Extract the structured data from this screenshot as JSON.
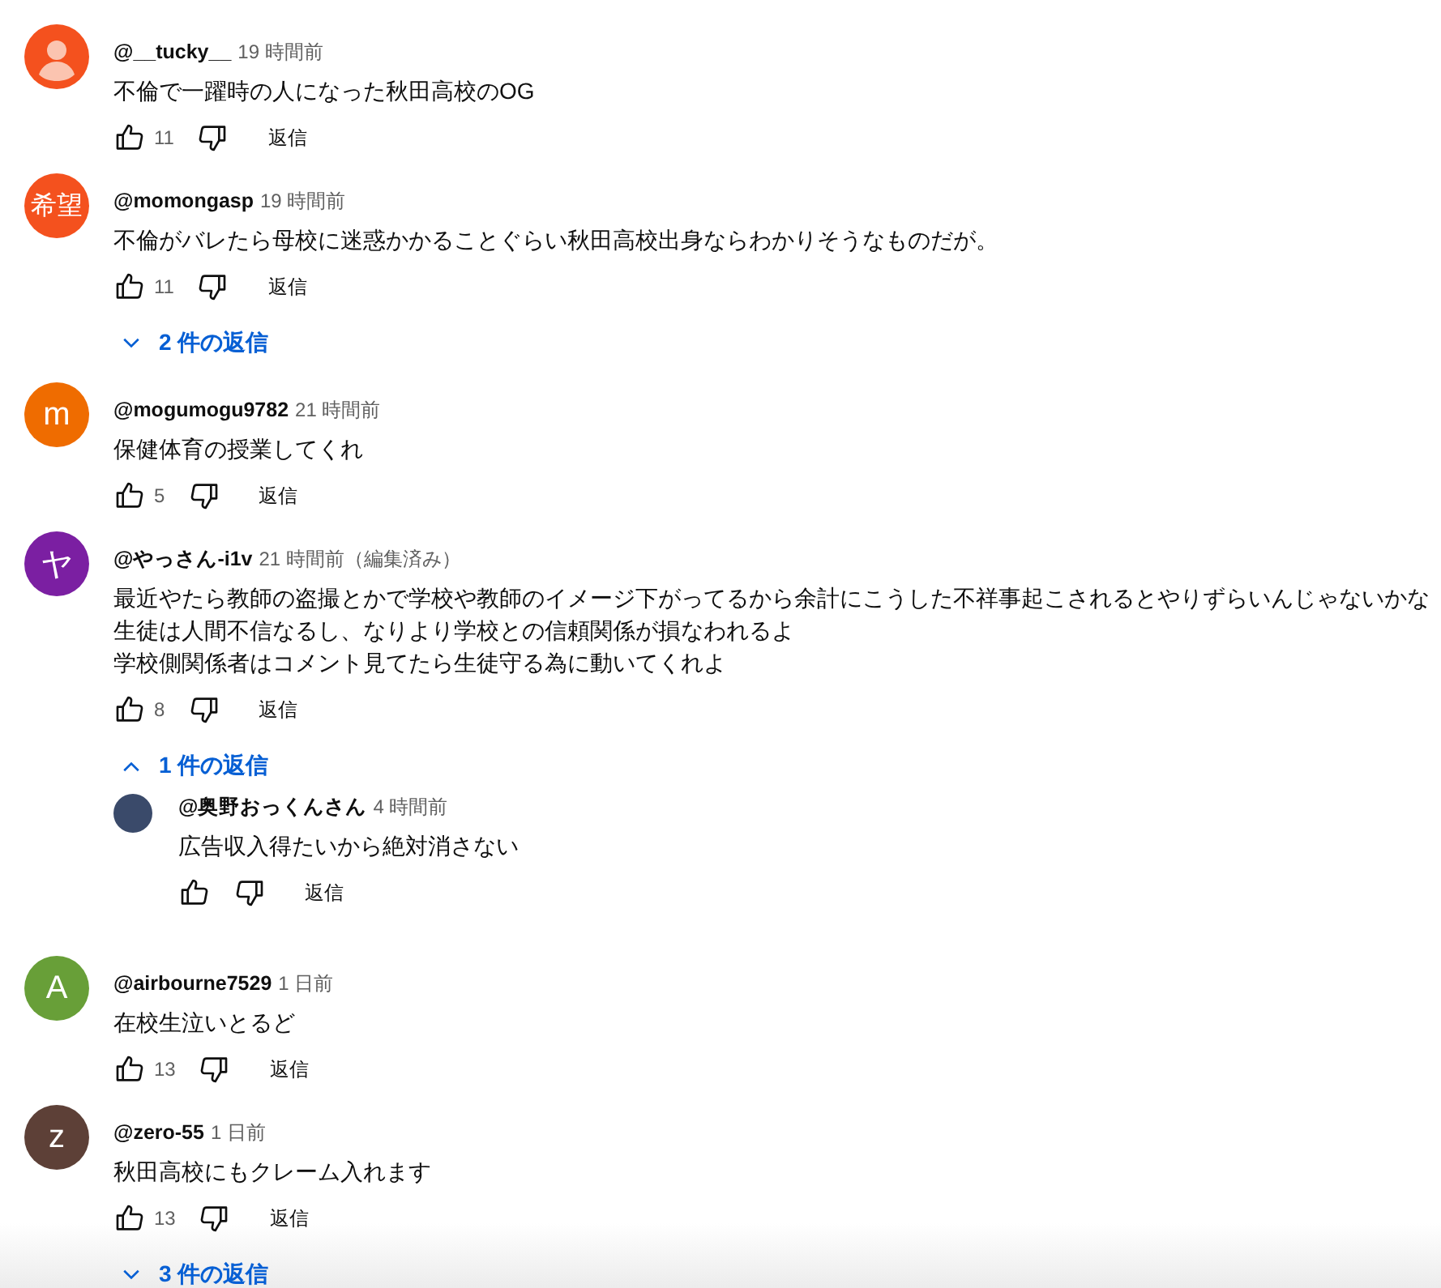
{
  "comments": [
    {
      "avatar": {
        "kind": "silhouette",
        "color": "#f4511e"
      },
      "author": "@__tucky__",
      "time": "19 時間前",
      "lines": [
        "不倫で一躍時の人になった秋田高校のOG"
      ],
      "likes": "11",
      "reply_label": "返信"
    },
    {
      "avatar": {
        "kind": "initial",
        "text": "希望",
        "color": "#f4511e"
      },
      "author": "@momongasp",
      "time": "19 時間前",
      "lines": [
        "不倫がバレたら母校に迷惑かかることぐらい秋田高校出身ならわかりそうなものだが。"
      ],
      "likes": "11",
      "reply_label": "返信",
      "replies_toggle": {
        "label": "2 件の返信",
        "expanded": false
      }
    },
    {
      "avatar": {
        "kind": "initial",
        "text": "m",
        "color": "#ef6c00"
      },
      "author": "@mogumogu9782",
      "time": "21 時間前",
      "lines": [
        "保健体育の授業してくれ"
      ],
      "likes": "5",
      "reply_label": "返信"
    },
    {
      "avatar": {
        "kind": "initial",
        "text": "ヤ",
        "color": "#7b1fa2"
      },
      "author": "@やっさん-i1v",
      "time": "21 時間前（編集済み）",
      "lines": [
        "最近やたら教師の盗撮とかで学校や教師のイメージ下がってるから余計にこうした不祥事起こされるとやりずらいんじゃないかな",
        "生徒は人間不信なるし、なりより学校との信頼関係が損なわれるよ",
        "学校側関係者はコメント見てたら生徒守る為に動いてくれよ"
      ],
      "likes": "8",
      "reply_label": "返信",
      "replies_toggle": {
        "label": "1 件の返信",
        "expanded": true
      },
      "replies": [
        {
          "avatar": {
            "kind": "photo",
            "color": "#3a4a6a"
          },
          "author": "@奥野おっくんさん",
          "time": "4 時間前",
          "lines": [
            "広告収入得たいから絶対消さない"
          ],
          "reply_label": "返信"
        }
      ]
    },
    {
      "avatar": {
        "kind": "initial",
        "text": "A",
        "color": "#689f38"
      },
      "author": "@airbourne7529",
      "time": "1 日前",
      "lines": [
        "在校生泣いとるど"
      ],
      "likes": "13",
      "reply_label": "返信"
    },
    {
      "avatar": {
        "kind": "initial",
        "text": "z",
        "color": "#5d4037"
      },
      "author": "@zero-55",
      "time": "1 日前",
      "lines": [
        "秋田高校にもクレーム入れます"
      ],
      "likes": "13",
      "reply_label": "返信",
      "replies_toggle": {
        "label": "3 件の返信",
        "expanded": false
      }
    }
  ]
}
